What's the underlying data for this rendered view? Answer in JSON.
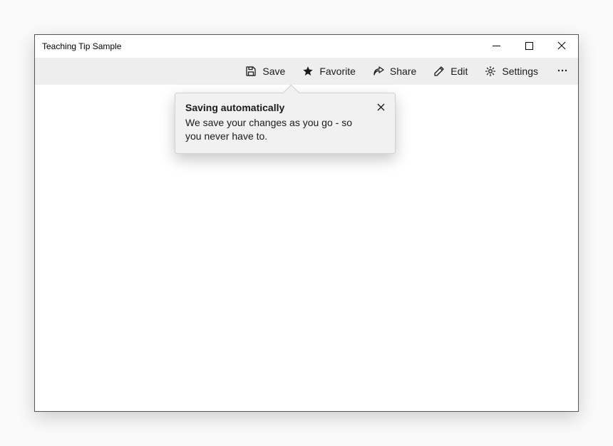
{
  "window": {
    "title": "Teaching Tip Sample"
  },
  "commandbar": {
    "save": {
      "label": "Save",
      "icon": "save-icon"
    },
    "favorite": {
      "label": "Favorite",
      "icon": "star-icon"
    },
    "share": {
      "label": "Share",
      "icon": "share-icon"
    },
    "edit": {
      "label": "Edit",
      "icon": "edit-icon"
    },
    "settings": {
      "label": "Settings",
      "icon": "settings-icon"
    },
    "more": {
      "icon": "more-icon"
    }
  },
  "teaching_tip": {
    "title": "Saving automatically",
    "body": "We save your changes as you go - so you never have to."
  }
}
